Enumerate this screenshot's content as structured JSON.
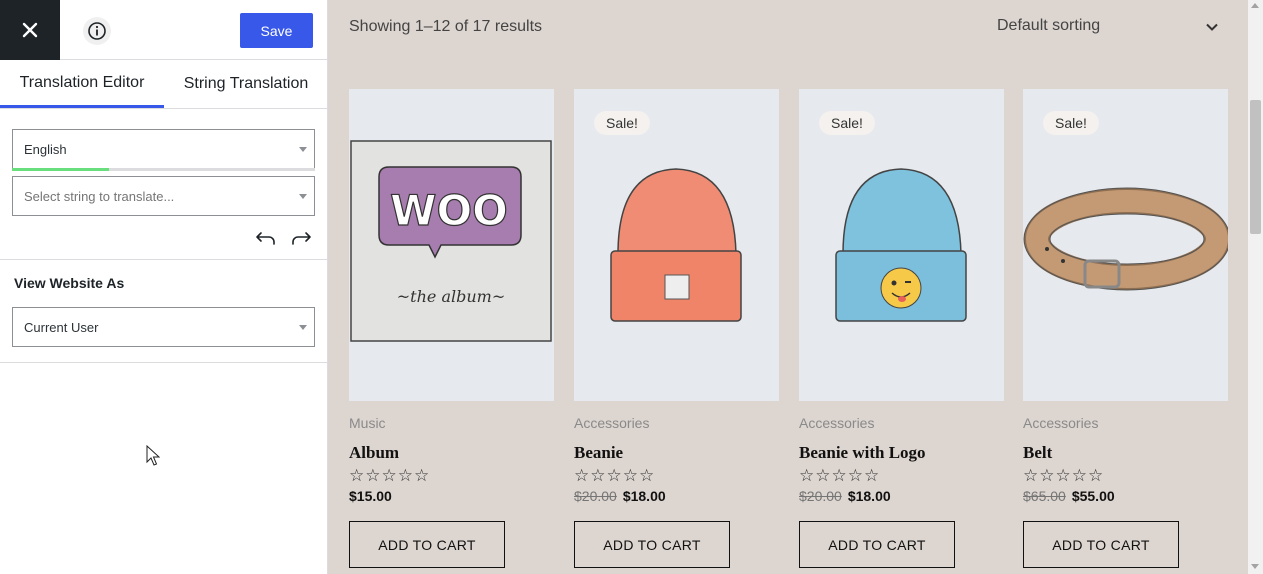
{
  "editor": {
    "close_icon": "close-icon",
    "info_icon": "info-icon",
    "save_label": "Save",
    "tabs": [
      {
        "label": "Translation Editor",
        "active": true
      },
      {
        "label": "String Translation",
        "active": false
      }
    ],
    "language": {
      "value": "English",
      "progress": 0.32
    },
    "string_select": {
      "placeholder": "Select string to translate..."
    },
    "undo_icon": "undo-icon",
    "redo_icon": "redo-icon",
    "view_as": {
      "label": "View Website As",
      "value": "Current User"
    }
  },
  "shop": {
    "result_count": "Showing 1–12 of 17 results",
    "sorting": "Default sorting",
    "sale_label": "Sale!",
    "add_to_cart": "ADD TO CART",
    "stars": "☆☆☆☆☆",
    "products": [
      {
        "category": "Music",
        "title": "Album",
        "price": "$15.00",
        "old_price": "",
        "sale": false,
        "image": "album-image"
      },
      {
        "category": "Accessories",
        "title": "Beanie",
        "price": "$18.00",
        "old_price": "$20.00",
        "sale": true,
        "image": "beanie-image"
      },
      {
        "category": "Accessories",
        "title": "Beanie with Logo",
        "price": "$18.00",
        "old_price": "$20.00",
        "sale": true,
        "image": "beanie-logo-image"
      },
      {
        "category": "Accessories",
        "title": "Belt",
        "price": "$55.00",
        "old_price": "$65.00",
        "sale": true,
        "image": "belt-image"
      }
    ]
  },
  "colors": {
    "accent": "#3858e9",
    "progress": "#68de7c",
    "preview_bg": "#ddd5d0",
    "dark": "#1d2327"
  }
}
